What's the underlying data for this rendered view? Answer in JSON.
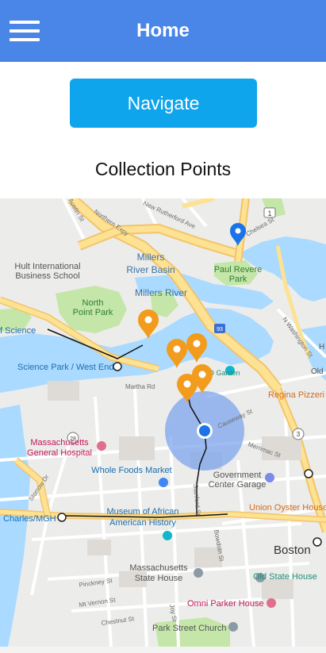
{
  "header": {
    "title": "Home",
    "menu_icon": "hamburger-menu-icon"
  },
  "navigate_button": {
    "label": "Navigate"
  },
  "section": {
    "title": "Collection Points"
  },
  "map": {
    "labels": {
      "millers_river_basin": "Millers River Basin",
      "millers_river": "Millers River",
      "hult_1": "Hult International",
      "hult_2": "Business School",
      "north_point_1": "North",
      "north_point_2": "Point Park",
      "paul_revere_1": "Paul Revere",
      "paul_revere_2": "Park",
      "science_park": "Science Park / West End",
      "of_science": "f Science",
      "mass_general_1": "Massachusetts",
      "mass_general_2": "General Hospital",
      "whole_foods": "Whole Foods Market",
      "government_center_1": "Government",
      "government_center_2": "Center Garage",
      "union_oyster": "Union Oyster House",
      "charles_mgh": "Charles/MGH",
      "museum_1": "Museum of African",
      "museum_2": "American History",
      "boston": "Boston",
      "state_house_1": "Massachusetts",
      "state_house_2": "State House",
      "old_state_house": "Old State House",
      "omni_parker": "Omni Parker House",
      "park_street": "Park Street Church",
      "regina_pizza": "Regina Pizzeri",
      "td_garden": "TD Garden",
      "old": "Old",
      "h_letter": "H",
      "northern_expy": "Northern Expy",
      "new_rutherford": "New Rutherford Ave",
      "martha_rd": "Martha Rd",
      "causeway_st": "Causeway St",
      "merrimac_st": "Merrimac St",
      "stanford_st": "Stanford St",
      "bowdoin_st": "Bowdoin St",
      "storrow_dr": "Storrow Dr",
      "n_washington": "N Washington St",
      "chelsea_st": "Chelsea St",
      "austin_st": "Austin St",
      "pinckney_st": "Pinckney St",
      "mt_vernon_st": "Mt Vernon St",
      "chestnut_st": "Chestnut St",
      "joy_st": "Joy St",
      "route_1": "1",
      "route_3": "3",
      "route_28": "28",
      "route_93": "93"
    },
    "colors": {
      "water": "#aadaff",
      "park": "#c4e6a8",
      "highway": "#fde293",
      "highway_edge": "#f3c46a",
      "collection_pin": "#f29b1d",
      "current_location": "#1a73e8",
      "accuracy_circle": "#7ea6ee",
      "route_line": "#111111"
    }
  }
}
